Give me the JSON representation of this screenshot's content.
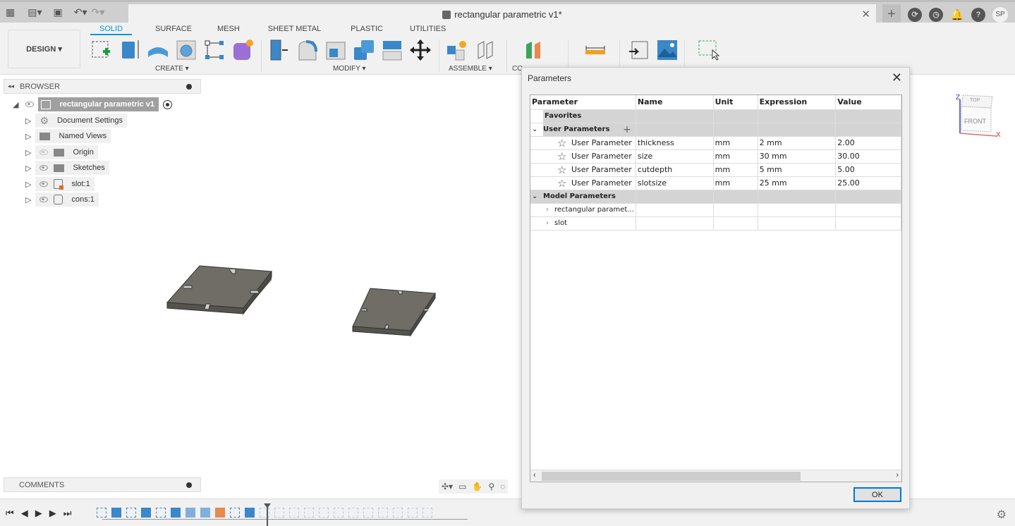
{
  "window": {
    "title": "rectangular parametric v1*",
    "avatar_initials": "SP"
  },
  "workspace": {
    "label": "DESIGN"
  },
  "ribbon": {
    "tabs": [
      {
        "label": "SOLID",
        "active": true
      },
      {
        "label": "SURFACE"
      },
      {
        "label": "MESH"
      },
      {
        "label": "SHEET METAL"
      },
      {
        "label": "PLASTIC"
      },
      {
        "label": "UTILITIES"
      }
    ],
    "groups": {
      "create": "CREATE",
      "modify": "MODIFY",
      "assemble": "ASSEMBLE",
      "construct": "CO"
    }
  },
  "browser": {
    "title": "BROWSER",
    "root": "rectangular parametric v1",
    "items": [
      {
        "label": "Document Settings"
      },
      {
        "label": "Named Views"
      },
      {
        "label": "Origin"
      },
      {
        "label": "Sketches"
      },
      {
        "label": "slot:1"
      },
      {
        "label": "cons:1"
      }
    ]
  },
  "comments": {
    "title": "COMMENTS"
  },
  "viewcube": {
    "top": "TOP",
    "front": "FRONT",
    "z": "Z",
    "x": "X"
  },
  "dialog": {
    "title": "Parameters",
    "columns": [
      "Parameter",
      "Name",
      "Unit",
      "Expression",
      "Value"
    ],
    "favorites_label": "Favorites",
    "user_params_label": "User Parameters",
    "user_params": [
      {
        "type": "User Parameter",
        "name": "thickness",
        "unit": "mm",
        "expression": "2 mm",
        "value": "2.00"
      },
      {
        "type": "User Parameter",
        "name": "size",
        "unit": "mm",
        "expression": "30 mm",
        "value": "30.00"
      },
      {
        "type": "User Parameter",
        "name": "cutdepth",
        "unit": "mm",
        "expression": "5 mm",
        "value": "5.00"
      },
      {
        "type": "User Parameter",
        "name": "slotsize",
        "unit": "mm",
        "expression": "25 mm",
        "value": "25.00"
      }
    ],
    "model_params_label": "Model Parameters",
    "model_params": [
      {
        "name": "rectangular paramet..."
      },
      {
        "name": "slot"
      }
    ],
    "ok_label": "OK"
  }
}
